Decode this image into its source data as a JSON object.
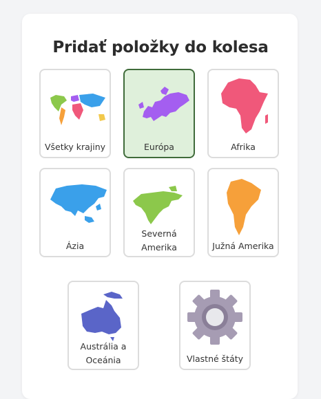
{
  "title": "Pridať položky do kolesa",
  "tiles": [
    {
      "label": "Všetky krajiny",
      "icon": "world-map-icon",
      "selected": false
    },
    {
      "label": "Európa",
      "icon": "europe-map-icon",
      "selected": true
    },
    {
      "label": "Afrika",
      "icon": "africa-map-icon",
      "selected": false
    },
    {
      "label": "Ázia",
      "icon": "asia-map-icon",
      "selected": false
    },
    {
      "label": "Severná Amerika",
      "icon": "north-america-map-icon",
      "selected": false
    },
    {
      "label": "Južná Amerika",
      "icon": "south-america-map-icon",
      "selected": false
    },
    {
      "label": "Austrália a Oceánia",
      "icon": "oceania-map-icon",
      "selected": false
    },
    {
      "label": "Vlastné štáty",
      "icon": "gear-icon",
      "selected": false
    }
  ],
  "colors": {
    "selected_background": "#dff0db",
    "selected_border": "#3f6b3a",
    "europe": "#a45ef0",
    "africa": "#f0587a",
    "asia": "#3aa0ea",
    "north_america": "#8cc84b",
    "south_america": "#f6a03a",
    "oceania": "#5a65c8",
    "gear": "#a69cb3"
  }
}
